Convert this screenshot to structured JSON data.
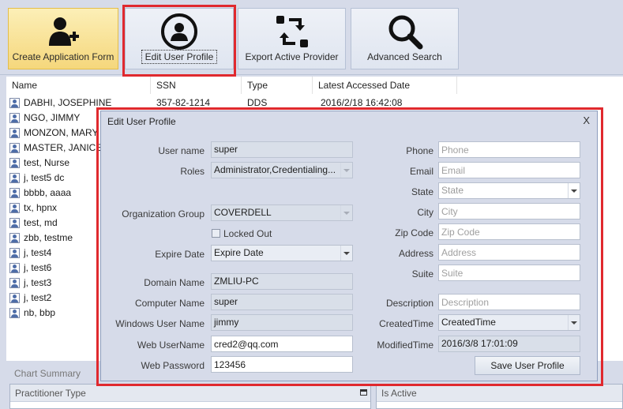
{
  "toolbar": {
    "buttons": [
      {
        "label": "Create Application Form",
        "icon": "add-user-icon"
      },
      {
        "label": "Edit User Profile",
        "icon": "user-circle-icon"
      },
      {
        "label": "Export Active Provider",
        "icon": "export-arrows-icon"
      },
      {
        "label": "Advanced Search",
        "icon": "magnifier-icon"
      }
    ]
  },
  "grid": {
    "columns": [
      "Name",
      "SSN",
      "Type",
      "Latest Accessed Date"
    ],
    "rows": [
      {
        "name": "DABHI, JOSEPHINE",
        "ssn": "357-82-1214",
        "type": "DDS",
        "date": "2016/2/18 16:42:08"
      },
      {
        "name": "NGO, JIMMY"
      },
      {
        "name": "MONZON, MARY"
      },
      {
        "name": "MASTER, JANICE"
      },
      {
        "name": "test, Nurse"
      },
      {
        "name": "j, test5 dc"
      },
      {
        "name": "bbbb, aaaa"
      },
      {
        "name": "tx, hpnx"
      },
      {
        "name": "test, md"
      },
      {
        "name": "zbb, testme"
      },
      {
        "name": "j, test4"
      },
      {
        "name": "j, test6"
      },
      {
        "name": "j, test3"
      },
      {
        "name": "j, test2"
      },
      {
        "name": "nb, bbp"
      }
    ]
  },
  "summary": {
    "title": "Chart Summary",
    "practitioner_type": "Practitioner Type",
    "is_active": "Is Active"
  },
  "dialog": {
    "title": "Edit User Profile",
    "close": "X",
    "labels": {
      "user_name": "User name",
      "roles": "Roles",
      "org_group": "Organization Group",
      "locked_out": "Locked Out",
      "expire_date": "Expire Date",
      "domain_name": "Domain Name",
      "computer_name": "Computer Name",
      "windows_user": "Windows User Name",
      "web_username": "Web UserName",
      "web_password": "Web Password",
      "phone": "Phone",
      "email": "Email",
      "state": "State",
      "city": "City",
      "zip": "Zip Code",
      "address": "Address",
      "suite": "Suite",
      "description": "Description",
      "created_time": "CreatedTime",
      "modified_time": "ModifiedTime"
    },
    "values": {
      "user_name": "super",
      "roles": "Administrator,Credentialing...",
      "org_group": "COVERDELL",
      "expire_date": "Expire Date",
      "domain_name": "ZMLIU-PC",
      "computer_name": "super",
      "windows_user": "jimmy",
      "web_username": "cred2@qq.com",
      "web_password": "123456",
      "created_time": "CreatedTime",
      "modified_time": "2016/3/8 17:01:09"
    },
    "placeholders": {
      "phone": "Phone",
      "email": "Email",
      "state": "State",
      "city": "City",
      "zip": "Zip Code",
      "address": "Address",
      "suite": "Suite",
      "description": "Description"
    },
    "save_label": "Save User Profile"
  },
  "colors": {
    "highlight": "#e0292e",
    "active_button": "#f5d77c",
    "background": "#d6dbe9"
  }
}
